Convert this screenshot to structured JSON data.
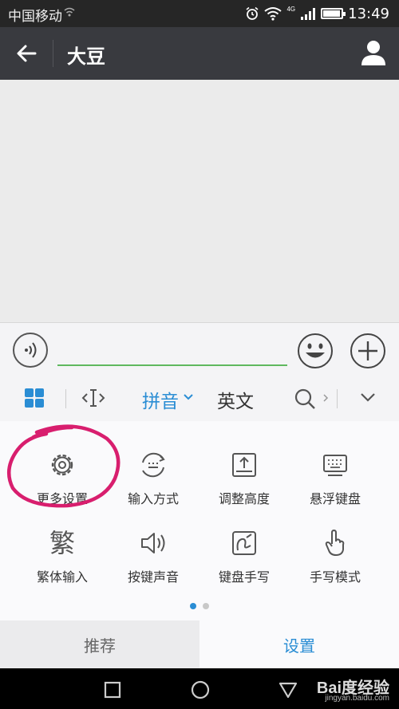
{
  "status_bar": {
    "carrier": "中国移动",
    "time": "13:49",
    "network_badge": "4G",
    "battery_level": 0.85
  },
  "title_bar": {
    "title": "大豆",
    "back_icon": "arrow-left-icon",
    "profile_icon": "person-icon"
  },
  "input_bar": {
    "text_value": "",
    "voice_icon": "voice-icon",
    "emoji_icon": "smiley-icon",
    "plus_icon": "plus-icon"
  },
  "keyboard_toolbar": {
    "pinyin_label": "拼音",
    "english_label": "英文",
    "accent_color": "#2a8dd4"
  },
  "settings_grid": [
    {
      "label": "更多设置",
      "icon": "gear-icon"
    },
    {
      "label": "输入方式",
      "icon": "keyboard-mode-icon"
    },
    {
      "label": "调整高度",
      "icon": "adjust-height-icon"
    },
    {
      "label": "悬浮键盘",
      "icon": "floating-keyboard-icon"
    },
    {
      "label": "繁体输入",
      "icon": "traditional-char-icon",
      "glyph": "繁"
    },
    {
      "label": "按键声音",
      "icon": "speaker-icon"
    },
    {
      "label": "键盘手写",
      "icon": "keyboard-handwrite-icon"
    },
    {
      "label": "手写模式",
      "icon": "hand-icon"
    }
  ],
  "pagination": {
    "pages": 2,
    "current": 1
  },
  "tabs": {
    "recommend": "推荐",
    "settings": "设置",
    "active": "settings"
  },
  "annotation_color": "#d81e6e",
  "watermark": {
    "main": "Bai度经验",
    "sub": "jingyan.baidu.com"
  }
}
